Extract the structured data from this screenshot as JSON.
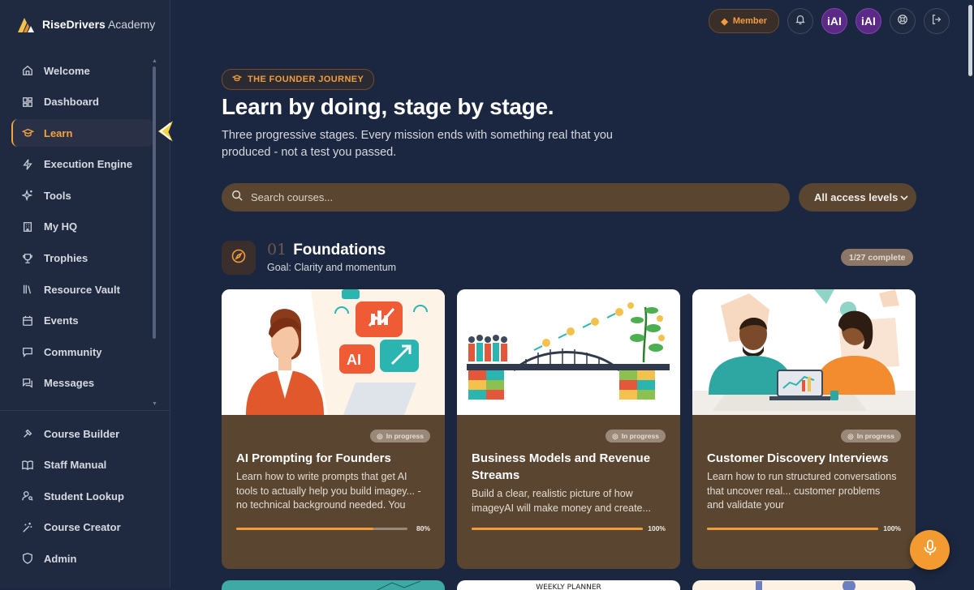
{
  "brand": {
    "name_bold": "RiseDrivers",
    "name_rest": " Academy"
  },
  "sidebar": {
    "items": [
      {
        "label": "Welcome",
        "icon": "home-icon"
      },
      {
        "label": "Dashboard",
        "icon": "dashboard-icon"
      },
      {
        "label": "Learn",
        "icon": "graduation-cap-icon",
        "active": true
      },
      {
        "label": "Execution Engine",
        "icon": "zap-icon"
      },
      {
        "label": "Tools",
        "icon": "sparkles-icon"
      },
      {
        "label": "My HQ",
        "icon": "building-icon"
      },
      {
        "label": "Trophies",
        "icon": "trophy-icon"
      },
      {
        "label": "Resource Vault",
        "icon": "library-icon"
      },
      {
        "label": "Events",
        "icon": "calendar-icon"
      },
      {
        "label": "Community",
        "icon": "chat-icon"
      },
      {
        "label": "Messages",
        "icon": "messages-icon"
      }
    ],
    "admin_items": [
      {
        "label": "Course Builder",
        "icon": "hammer-icon"
      },
      {
        "label": "Staff Manual",
        "icon": "book-icon"
      },
      {
        "label": "Student Lookup",
        "icon": "user-search-icon"
      },
      {
        "label": "Course Creator",
        "icon": "wand-icon"
      },
      {
        "label": "Admin",
        "icon": "shield-icon"
      }
    ]
  },
  "topbar": {
    "member_label": "Member",
    "avatar_1": "iAI",
    "avatar_2": "iAI"
  },
  "hero": {
    "pill": "THE FOUNDER JOURNEY",
    "title": "Learn by doing, stage by stage.",
    "subtitle": "Three progressive stages. Every mission ends with something real that you produced - not a test you passed."
  },
  "search": {
    "placeholder": "Search courses..."
  },
  "filter": {
    "selected": "All access levels"
  },
  "stage": {
    "number": "01",
    "name": "Foundations",
    "goal": "Goal: Clarity and momentum",
    "complete": "1/27 complete"
  },
  "courses": [
    {
      "badge": "In progress",
      "title": "AI Prompting for Founders",
      "description": "Learn how to write prompts that get AI tools to actually help you build imagey... - no technical background needed. You",
      "progress": 0.8,
      "progress_label": "80%"
    },
    {
      "badge": "In progress",
      "title": "Business Models and Revenue Streams",
      "description": "Build a clear, realistic picture of how imageyAI will make money and create...",
      "progress": 1.0,
      "progress_label": "100%"
    },
    {
      "badge": "In progress",
      "title": "Customer Discovery Interviews",
      "description": "Learn how to run structured conversations that uncover real... customer problems and validate your",
      "progress": 1.0,
      "progress_label": "100%"
    }
  ],
  "peek_cards": {
    "second_caption": "WEEKLY PLANNER"
  },
  "colors": {
    "accent": "#f39c3c",
    "background": "#1b2740",
    "card": "#5a4630",
    "sidebar": "#1f2a41"
  }
}
